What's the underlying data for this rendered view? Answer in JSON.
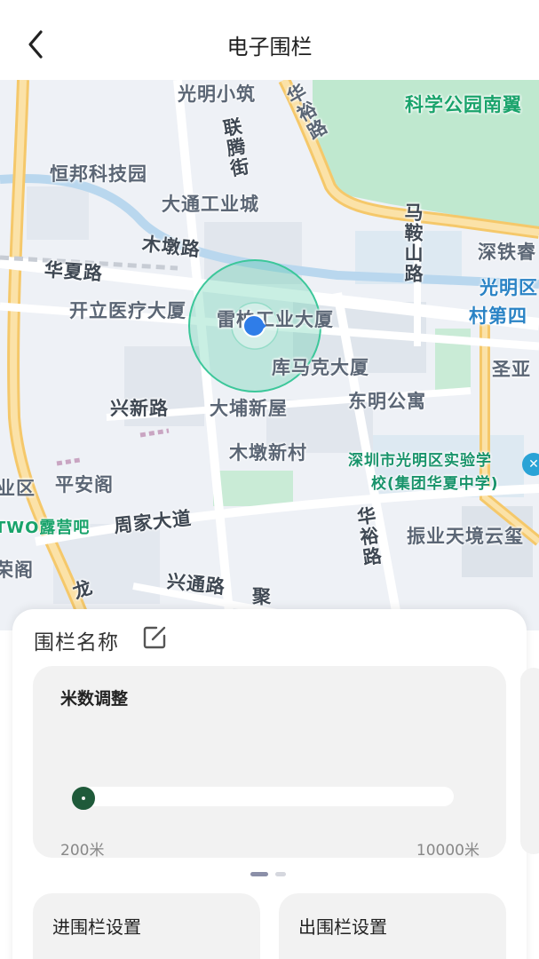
{
  "header": {
    "title": "电子围栏",
    "back_icon": "chevron-left-icon"
  },
  "map": {
    "labels": {
      "guangming_xiaozhu": "光明小筑",
      "huayu_road_top": "华裕路",
      "science_park": "科学公园南翼",
      "hengbang": "恒邦科技园",
      "lianteng_street": "联腾街",
      "datong_industrial": "大通工业城",
      "ma_an_shan_road": "马鞍山路",
      "shenzhen_railway": "深铁睿",
      "mudun_road": "木墩路",
      "huaxia_road": "华夏路",
      "guangming_district": "光明区",
      "kaili_medical": "开立医疗大厦",
      "leiyou_industrial": "雷柏工业大厦",
      "village_4": "村第四",
      "kumake": "库马克大厦",
      "sheng_ya": "圣亚",
      "xinxin_road": "兴新路",
      "dapu_xinwu": "大埔新屋",
      "dongming_apartment": "东明公寓",
      "mudun_xincun": "木墩新村",
      "school_line1": "深圳市光明区实验学",
      "school_line2": "校(集团华夏中学)",
      "ye_qu": "业区",
      "ping_an_ge": "平安阁",
      "two_camping": "TWO露营吧",
      "zhoujia_avenue": "周家大道",
      "huayu_road_bottom": "华裕路",
      "zhenye_tianjing": "振业天境云玺",
      "rong_ge": "荣阁",
      "xingtong_road": "兴通路",
      "long_road": "龙",
      "ju_road": "聚"
    },
    "current_location_icon": "location-arrow-icon",
    "school_icon": "school-poi-icon",
    "fence_color": "#3cc79a",
    "location_color": "#2f7de8"
  },
  "panel": {
    "fence_name_label": "围栏名称",
    "edit_icon": "edit-icon",
    "range": {
      "title": "米数调整",
      "min_label": "200米",
      "max_label": "10000米",
      "value_fraction": 0.0,
      "accent_color": "#1f5a3a"
    },
    "pager": {
      "count": 2,
      "active": 0
    },
    "enter_fence_label": "进围栏设置",
    "exit_fence_label": "出围栏设置"
  }
}
